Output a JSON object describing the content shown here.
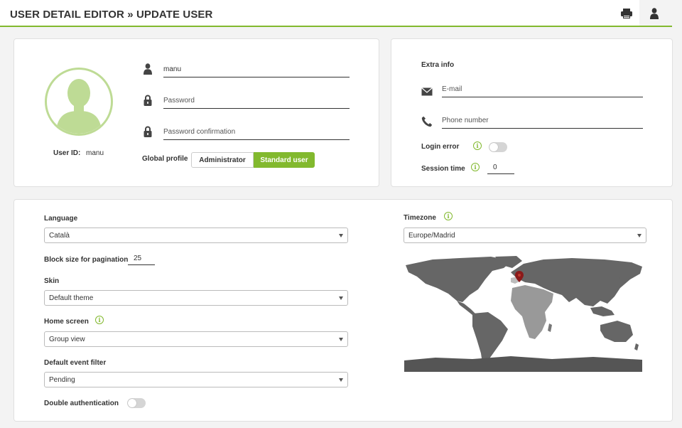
{
  "header": {
    "title": "USER DETAIL EDITOR » UPDATE USER",
    "icons": [
      "printer-icon",
      "user-icon"
    ]
  },
  "profile": {
    "user_id_label": "User ID:",
    "user_id_value": "manu",
    "username_value": "manu",
    "password_placeholder": "Password",
    "password_confirm_placeholder": "Password confirmation",
    "global_profile_label": "Global profile",
    "profile_options": [
      "Administrator",
      "Standard user"
    ],
    "selected_profile": "Standard user"
  },
  "extra": {
    "title": "Extra info",
    "email_placeholder": "E-mail",
    "phone_placeholder": "Phone number",
    "login_error_label": "Login error",
    "login_error_enabled": false,
    "session_time_label": "Session time",
    "session_time_value": "0"
  },
  "settings": {
    "language_label": "Language",
    "language_value": "Català",
    "block_size_label": "Block size for pagination",
    "block_size_value": "25",
    "skin_label": "Skin",
    "skin_value": "Default theme",
    "home_screen_label": "Home screen",
    "home_screen_value": "Group view",
    "event_filter_label": "Default event filter",
    "event_filter_value": "Pending",
    "double_auth_label": "Double authentication",
    "double_auth_enabled": false
  },
  "timezone": {
    "label": "Timezone",
    "value": "Europe/Madrid"
  },
  "colors": {
    "accent": "#82b92e",
    "avatar": "#bedb95",
    "map_land": "#666666",
    "map_highlight": "#8b1a1a"
  }
}
